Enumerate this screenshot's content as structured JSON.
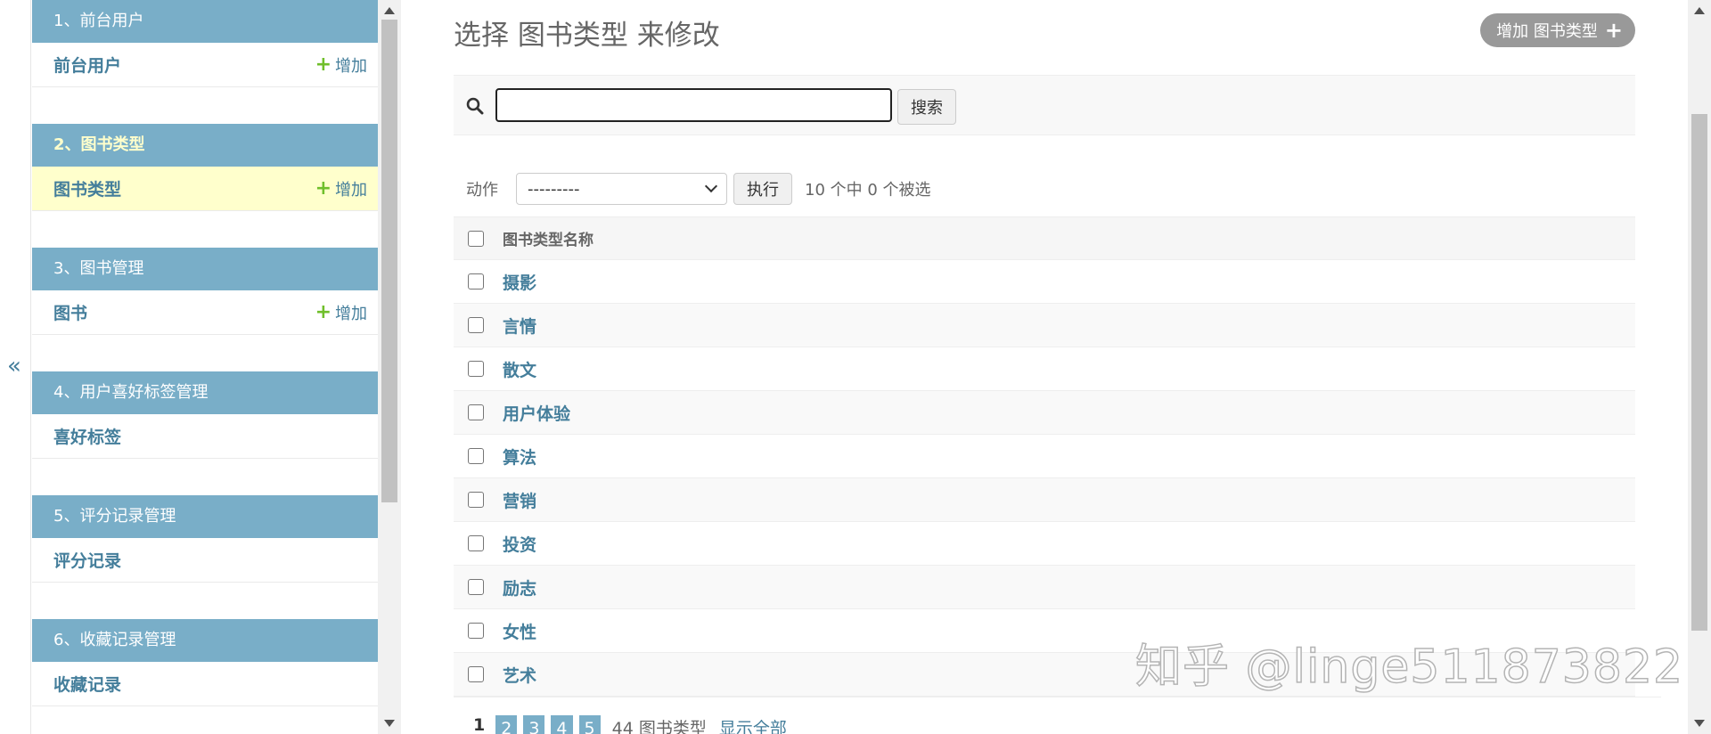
{
  "sidebar": {
    "collapse_toggle": "«",
    "modules": [
      {
        "caption": "1、前台用户",
        "models": [
          {
            "name": "前台用户",
            "add": "增加"
          }
        ]
      },
      {
        "caption": "2、图书类型",
        "models": [
          {
            "name": "图书类型",
            "add": "增加"
          }
        ]
      },
      {
        "caption": "3、图书管理",
        "models": [
          {
            "name": "图书",
            "add": "增加"
          }
        ]
      },
      {
        "caption": "4、用户喜好标签管理",
        "models": [
          {
            "name": "喜好标签"
          }
        ]
      },
      {
        "caption": "5、评分记录管理",
        "models": [
          {
            "name": "评分记录"
          }
        ]
      },
      {
        "caption": "6、收藏记录管理",
        "models": [
          {
            "name": "收藏记录"
          }
        ]
      }
    ]
  },
  "main": {
    "title": "选择 图书类型 来修改",
    "add_button": "增加 图书类型",
    "search": {
      "value": "",
      "button": "搜索"
    },
    "actions": {
      "label": "动作",
      "selected": "---------",
      "go": "执行",
      "counter": "10 个中 0 个被选"
    },
    "table": {
      "header": "图书类型名称",
      "rows": [
        "摄影",
        "言情",
        "散文",
        "用户体验",
        "算法",
        "营销",
        "投资",
        "励志",
        "女性",
        "艺术"
      ]
    },
    "paginator": {
      "current": "1",
      "pages": [
        "2",
        "3",
        "4",
        "5"
      ],
      "total": "44 图书类型",
      "show_all": "显示全部"
    }
  },
  "watermark": "知乎 @linge511873822",
  "colors": {
    "module_header": "#79aec8",
    "link": "#447e9b",
    "add_plus": "#70bf2b",
    "current_row": "#ffffcc"
  }
}
